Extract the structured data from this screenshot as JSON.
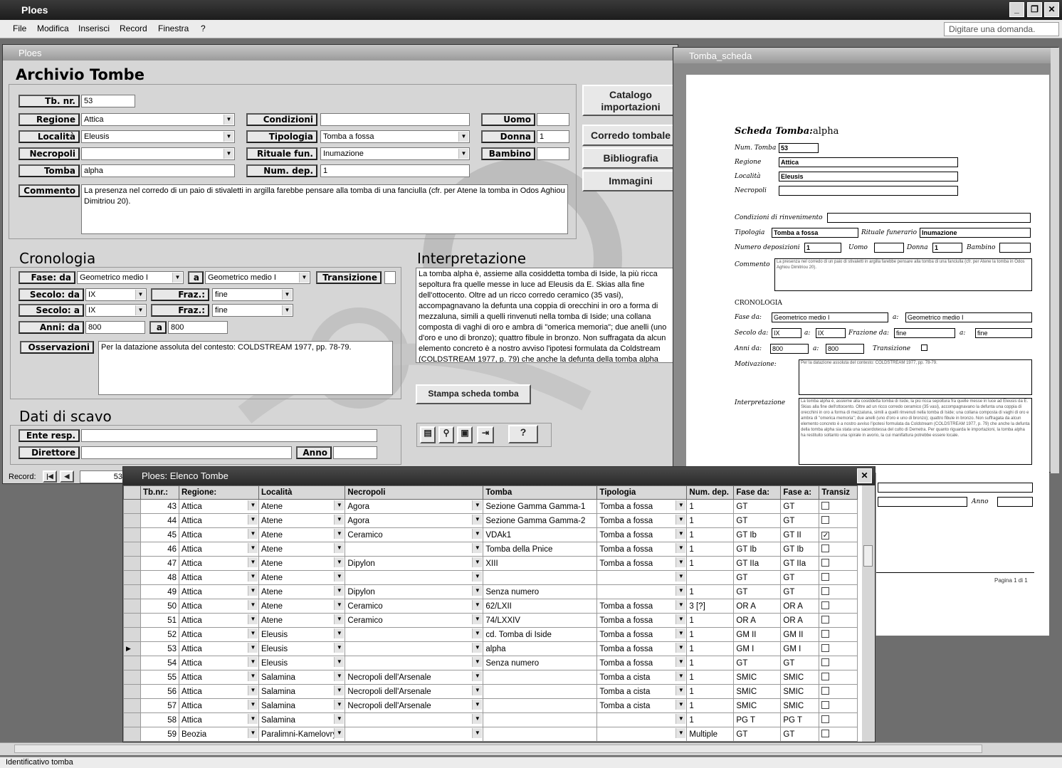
{
  "app": {
    "title": "Ploes",
    "menu": [
      "File",
      "Modifica",
      "Inserisci",
      "Record",
      "Finestra",
      "?"
    ],
    "ask_placeholder": "Digitare una domanda."
  },
  "main_form": {
    "window_title": "Ploes",
    "heading": "Archivio Tombe",
    "labels": {
      "tb_nr": "Tb. nr.",
      "regione": "Regione",
      "localita": "Località",
      "necropoli": "Necropoli",
      "tomba": "Tomba",
      "commento": "Commento",
      "condizioni": "Condizioni",
      "tipologia": "Tipologia",
      "rituale": "Rituale fun.",
      "num_dep": "Num. dep.",
      "uomo": "Uomo",
      "donna": "Donna",
      "bambino": "Bambino"
    },
    "values": {
      "tb_nr": "53",
      "regione": "Attica",
      "localita": "Eleusis",
      "necropoli": "",
      "tomba": "alpha",
      "condizioni": "",
      "tipologia": "Tomba a fossa",
      "rituale": "Inumazione",
      "num_dep": "1",
      "uomo": "",
      "donna": "1",
      "bambino": "",
      "commento": "La presenza nel corredo di un paio di stivaletti in argilla farebbe pensare alla tomba di una fanciulla (cfr. per Atene la tomba in Odos Aghiou Dimitriou 20)."
    },
    "side_buttons": [
      "Catalogo importazioni",
      "Corredo tombale",
      "Bibliografia",
      "Immagini"
    ],
    "cronologia": {
      "heading": "Cronologia",
      "fase_da_label": "Fase: da",
      "fase_da": "Geometrico medio I",
      "a_label": "a",
      "fase_a": "Geometrico medio I",
      "transizione_label": "Transizione",
      "secolo_da_label": "Secolo: da",
      "secolo_da": "IX",
      "fraz_label": "Fraz.:",
      "fraz_da": "fine",
      "secolo_a_label": "Secolo: a",
      "secolo_a": "IX",
      "fraz_a": "fine",
      "anni_da_label": "Anni: da",
      "anni_da": "800",
      "anni_a": "800",
      "osservazioni_label": "Osservazioni",
      "osservazioni": "Per la datazione  assoluta del contesto: COLDSTREAM 1977, pp. 78-79."
    },
    "interpretazione": {
      "heading": "Interpretazione",
      "text": "La tomba alpha è, assieme alla cosiddetta tomba di Iside, la più ricca sepoltura fra quelle messe in luce ad Eleusis da E. Skias alla fine dell'ottocento. Oltre ad un ricco corredo ceramico (35 vasi), accompagnavano la defunta una coppia di orecchini in oro a forma di mezzaluna, simili a quelli rinvenuti nella tomba di Iside; una collana composta di vaghi di oro e ambra di \"omerica memoria\"; due anelli (uno d'oro e uno di bronzo); quattro fibule in bronzo. Non suffragata da alcun elemento concreto è a nostro avviso l'ipotesi formulata da Coldstream (COLDSTREAM 1977, p. 79) che anche la defunta della tomba alpha sia stata una sacerdotessa del culto di Demetra. Per quanto riguarda le"
    },
    "print_button": "Stampa scheda tomba",
    "scavo": {
      "heading": "Dati di scavo",
      "ente_label": "Ente resp.",
      "direttore_label": "Direttore",
      "anno_label": "Anno"
    },
    "record_label": "Record:",
    "record_value": "53"
  },
  "report": {
    "window_title": "Tomba_scheda",
    "title": "Scheda Tomba:",
    "title_value": "alpha",
    "num_tomba_label": "Num. Tomba",
    "num_tomba": "53",
    "regione_label": "Regione",
    "regione": "Attica",
    "localita_label": "Località",
    "localita": "Eleusis",
    "necropoli_label": "Necropoli",
    "condizioni_label": "Condizioni di rinvenimento",
    "tipologia_label": "Tipologia",
    "tipologia": "Tomba a fossa",
    "rituale_label": "Rituale funerario",
    "rituale": "Inumazione",
    "numero_label": "Numero deposizioni",
    "numero": "1",
    "uomo_label": "Uomo",
    "donna_label": "Donna",
    "donna": "1",
    "bambino_label": "Bambino",
    "commento_label": "Commento",
    "commento": "La presenza nel corredo di un paio di stivaletti in argilla farebbe pensare alla tomba di una fanciulla (cfr. per Atene la tomba in Odos Aghiou Dimitriou 20).",
    "cronologia_label": "CRONOLOGIA",
    "fase_label": "Fase da:",
    "fase_da": "Geometrico medio I",
    "a_label": "a:",
    "fase_a": "Geometrico medio I",
    "secolo_label": "Secolo da:",
    "secolo_da": "IX",
    "secolo_a": "IX",
    "frazione_label": "Frazione da:",
    "fraz_da": "fine",
    "fraz_a": "fine",
    "anni_label": "Anni da:",
    "anni_da": "800",
    "anni_a": "800",
    "transizione_label": "Transizione",
    "motivazione_label": "Motivazione:",
    "motivazione": "Per la datazione  assoluta del contesto: COLDSTREAM 1977, pp. 78-79.",
    "interpretazione_label": "Interpretazione",
    "interpretazione": "La tomba alpha è, assieme alla cosiddetta tomba di Iside, la più ricca sepoltura fra quelle messe in luce ad Eleusis da E. Skias alla fine dell'ottocento. Oltre ad un ricco corredo ceramico (35 vasi), accompagnavano la defunta una coppia di orecchini in oro a forma di mezzaluna, simili a quelli rinvenuti nella tomba di Iside; una collana composta di vaghi di oro e ambra di \"omerica memoria\"; due anelli (uno d'oro e uno di bronzo); quattro fibule in bronzo. Non suffragata da alcun elemento concreto è a nostro avviso l'ipotesi formulata da Coldstream (COLDSTREAM 1977, p. 79) che anche la defunta della tomba alpha sia stata una sacerdotessa del culto di Demetra. Per quanto riguarda le importazioni, la tomba alpha ha restituito soltanto una spirale in avorio, la cui manifattura potrebbe essere locale.",
    "anno_label": "Anno",
    "page": "Pagina 1 di 1"
  },
  "list": {
    "window_title": "Ploes: Elenco Tombe",
    "columns": [
      "Tb.nr.:",
      "Regione:",
      "Località",
      "Necropoli",
      "Tomba",
      "Tipologia",
      "Num. dep.",
      "Fase da:",
      "Fase a:",
      "Transiz"
    ],
    "rows": [
      [
        "43",
        "Attica",
        "Atene",
        "Agora",
        "Sezione Gamma Gamma-1",
        "Tomba a fossa",
        "1",
        "GT",
        "GT",
        false
      ],
      [
        "44",
        "Attica",
        "Atene",
        "Agora",
        "Sezione Gamma Gamma-2",
        "Tomba a fossa",
        "1",
        "GT",
        "GT",
        false
      ],
      [
        "45",
        "Attica",
        "Atene",
        "Ceramico",
        "VDAk1",
        "Tomba a fossa",
        "1",
        "GT Ib",
        "GT II",
        true
      ],
      [
        "46",
        "Attica",
        "Atene",
        "",
        "Tomba della Pnice",
        "Tomba a fossa",
        "1",
        "GT Ib",
        "GT Ib",
        false
      ],
      [
        "47",
        "Attica",
        "Atene",
        "Dipylon",
        "XIII",
        "Tomba a fossa",
        "1",
        "GT IIa",
        "GT IIa",
        false
      ],
      [
        "48",
        "Attica",
        "Atene",
        "",
        "",
        "",
        "",
        "GT",
        "GT",
        false
      ],
      [
        "49",
        "Attica",
        "Atene",
        "Dipylon",
        "Senza numero",
        "",
        "1",
        "GT",
        "GT",
        false
      ],
      [
        "50",
        "Attica",
        "Atene",
        "Ceramico",
        "62/LXII",
        "Tomba a fossa",
        "3 [?]",
        "OR A",
        "OR A",
        false
      ],
      [
        "51",
        "Attica",
        "Atene",
        "Ceramico",
        "74/LXXIV",
        "Tomba a fossa",
        "1",
        "OR A",
        "OR A",
        false
      ],
      [
        "52",
        "Attica",
        "Eleusis",
        "",
        "cd. Tomba di Iside",
        "Tomba a fossa",
        "1",
        "GM II",
        "GM II",
        false
      ],
      [
        "53",
        "Attica",
        "Eleusis",
        "",
        "alpha",
        "Tomba a fossa",
        "1",
        "GM I",
        "GM I",
        false
      ],
      [
        "54",
        "Attica",
        "Eleusis",
        "",
        "Senza numero",
        "Tomba a fossa",
        "1",
        "GT",
        "GT",
        false
      ],
      [
        "55",
        "Attica",
        "Salamina",
        "Necropoli dell'Arsenale",
        "",
        "Tomba a cista",
        "1",
        "SMIC",
        "SMIC",
        false
      ],
      [
        "56",
        "Attica",
        "Salamina",
        "Necropoli dell'Arsenale",
        "",
        "Tomba a cista",
        "1",
        "SMIC",
        "SMIC",
        false
      ],
      [
        "57",
        "Attica",
        "Salamina",
        "Necropoli dell'Arsenale",
        "",
        "Tomba a cista",
        "1",
        "SMIC",
        "SMIC",
        false
      ],
      [
        "58",
        "Attica",
        "Salamina",
        "",
        "",
        "",
        "1",
        "PG T",
        "PG T",
        false
      ],
      [
        "59",
        "Beozia",
        "Paralimni-Kamelovrysi",
        "",
        "",
        "",
        "Multiple",
        "GT",
        "GT",
        false
      ]
    ],
    "current_row": 10
  },
  "status": {
    "text": "Identificativo tomba"
  }
}
